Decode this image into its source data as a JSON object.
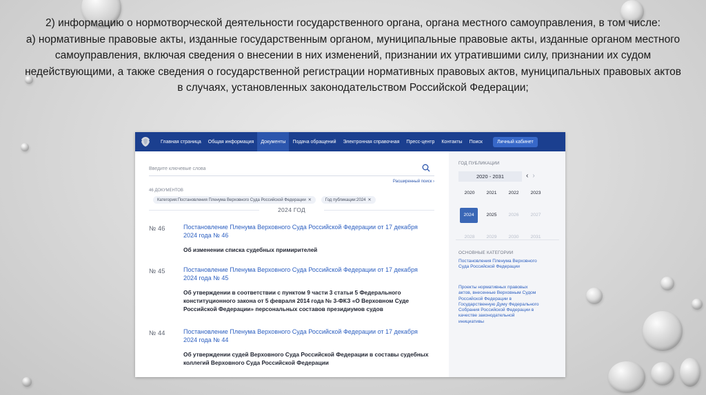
{
  "slide": {
    "line1": "2) информацию о нормотворческой деятельности государственного органа, органа местного самоуправления, в том числе:",
    "line2": "а) нормативные правовые акты, изданные государственным органом, муниципальные правовые акты, изданные органом местного самоуправления, включая сведения о внесении в них изменений, признании их утратившими силу, признании их судом недействующими, а также сведения о государственной регистрации нормативных правовых актов, муниципальных правовых актов в случаях, установленных законодательством Российской Федерации;"
  },
  "nav": {
    "items": [
      "Главная страница",
      "Общая информация",
      "Документы",
      "Подача обращений",
      "Электронная справочная",
      "Пресс-центр",
      "Контакты",
      "Поиск"
    ],
    "cabinet": "Личный кабинет"
  },
  "search": {
    "placeholder": "Введите ключевые слова",
    "advanced": "Расширенный поиск ›"
  },
  "results": {
    "count": "46 ДОКУМЕНТОВ",
    "chips": [
      "Категория:Постановления Пленума Верховного Суда Российской Федерации",
      "Год публикации:2024"
    ],
    "chip_close": "✕",
    "year_heading": "2024 ГОД",
    "documents": [
      {
        "number": "№ 46",
        "title": "Постановление Пленума Верховного Суда Российской Федерации от 17 декабря 2024 года № 46",
        "description": "Об изменении списка судебных примирителей"
      },
      {
        "number": "№ 45",
        "title": "Постановление Пленума Верховного Суда Российской Федерации от 17 декабря 2024 года № 45",
        "description": "Об утверждении в соответствии с пунктом 9 части 3 статьи 5 Федерального конституционного закона от 5 февраля 2014 года № 3-ФКЗ «О Верховном Суде Российской Федерации» персональных составов президиумов судов"
      },
      {
        "number": "№ 44",
        "title": "Постановление Пленума Верховного Суда Российской Федерации от 17 декабря 2024 года № 44",
        "description": "Об утверждении судей Верховного Суда Российской Федерации в составы судебных коллегий Верховного Суда Российской Федерации"
      }
    ]
  },
  "sidebar": {
    "year_label": "ГОД ПУБЛИКАЦИИ",
    "range": "2020 - 2031",
    "prev": "‹",
    "next": "›",
    "years": [
      {
        "label": "2020",
        "state": "normal"
      },
      {
        "label": "2021",
        "state": "normal"
      },
      {
        "label": "2022",
        "state": "normal"
      },
      {
        "label": "2023",
        "state": "normal"
      },
      {
        "label": "2024",
        "state": "selected"
      },
      {
        "label": "2025",
        "state": "normal"
      },
      {
        "label": "2026",
        "state": "muted"
      },
      {
        "label": "2027",
        "state": "muted"
      },
      {
        "label": "2028",
        "state": "muted"
      },
      {
        "label": "2029",
        "state": "muted"
      },
      {
        "label": "2030",
        "state": "muted"
      },
      {
        "label": "2031",
        "state": "muted"
      }
    ],
    "categories_label": "ОСНОВНЫЕ КАТЕГОРИИ",
    "categories": [
      "Постановления Пленума Верховного Суда Российской Федерации",
      "Проекты нормативных правовых актов, внесенные Верховным Судом Российской Федерации в Государственную Думу Федерального Собрания Российской Федерации в качестве законодательной инициативы"
    ]
  },
  "colors": {
    "nav_bg": "#1b3f8f",
    "link": "#2c5fc0",
    "selected_year": "#3a67b6"
  }
}
